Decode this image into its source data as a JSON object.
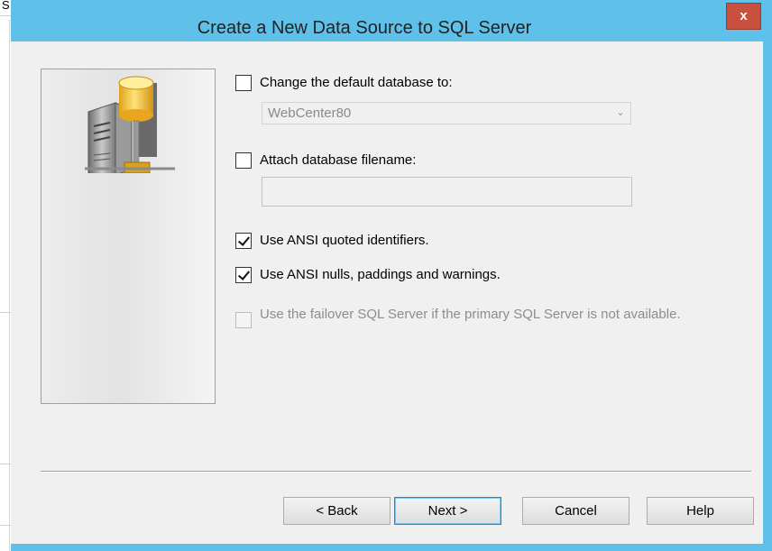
{
  "background_fragment": "S",
  "window": {
    "title": "Create a New Data Source to SQL Server",
    "close_label": "x"
  },
  "options": {
    "change_default_db": {
      "label": "Change the default database to:",
      "checked": false
    },
    "default_db_value": "WebCenter80",
    "attach_db_filename": {
      "label": "Attach database filename:",
      "checked": false
    },
    "attach_db_value": "",
    "ansi_quoted": {
      "label": "Use ANSI quoted identifiers.",
      "checked": true
    },
    "ansi_nulls": {
      "label": "Use ANSI nulls, paddings and warnings.",
      "checked": true
    },
    "failover": {
      "label": "Use the failover SQL Server if the primary SQL Server is not available.",
      "checked": false,
      "enabled": false
    }
  },
  "buttons": {
    "back": "< Back",
    "next": "Next >",
    "cancel": "Cancel",
    "help": "Help"
  },
  "colors": {
    "frame": "#5fc1ea",
    "close": "#c7503f",
    "client": "#f0f0f0"
  },
  "icons": {
    "server": "database-server-icon",
    "dropdown": "chevron-down-icon"
  }
}
